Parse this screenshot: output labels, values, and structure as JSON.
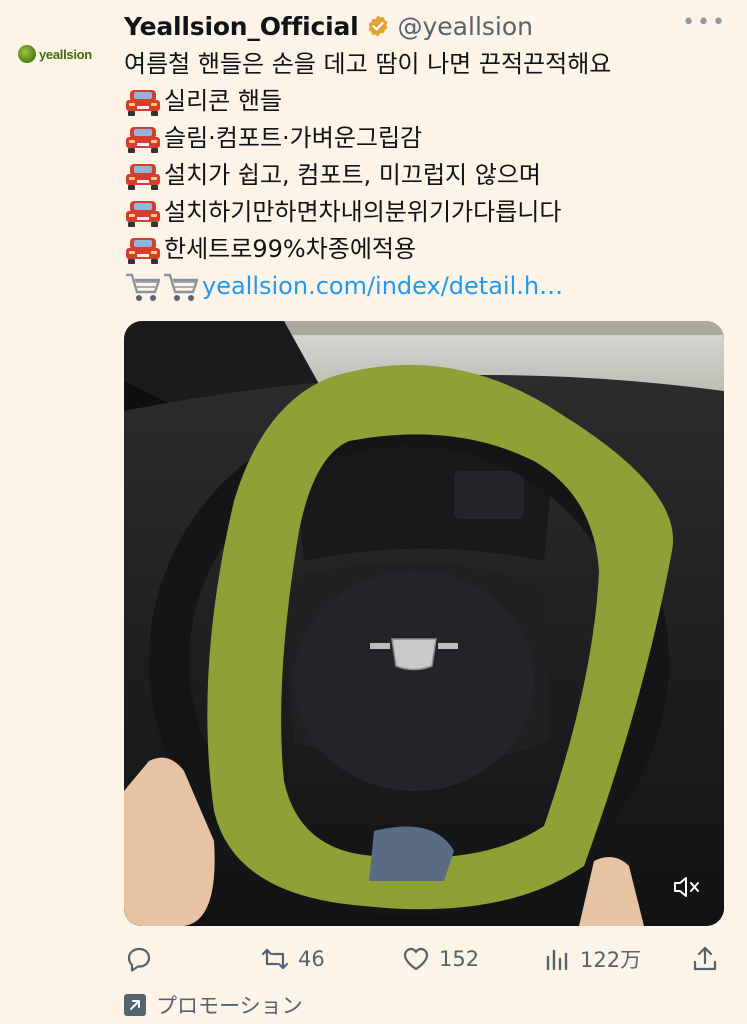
{
  "author": {
    "avatar_text": "yeallsion",
    "display_name": "Yeallsion_Official",
    "handle": "@yeallsion",
    "verified": true
  },
  "tweet": {
    "lines": [
      "여름철 핸들은 손을 데고 땀이 나면 끈적끈적해요",
      "실리콘 핸들",
      "슬림·컴포트·가벼운그립감",
      "설치가 쉽고, 컴포트, 미끄럽지 않으며",
      "설치하기만하면차내의분위기가다릅니다",
      "한세트로99%차종에적용"
    ],
    "link": "yeallsion.com/index/detail.h…"
  },
  "media": {
    "type": "video",
    "muted": true
  },
  "actions": {
    "replies": "",
    "retweets": "46",
    "likes": "152",
    "views": "122万"
  },
  "promo_label": "プロモーション",
  "colors": {
    "background": "#fdf3e6",
    "link": "#1d9bf0",
    "muted_text": "#536471",
    "verified_badge": "#e2a336",
    "steering_cover": "#8fa037"
  },
  "icons": {
    "more": "more-icon",
    "reply": "reply-icon",
    "retweet": "retweet-icon",
    "like": "heart-icon",
    "views": "views-icon",
    "share": "share-icon",
    "mute": "mute-icon",
    "bullet": "car-emoji-icon",
    "cart": "cart-emoji-icon"
  }
}
